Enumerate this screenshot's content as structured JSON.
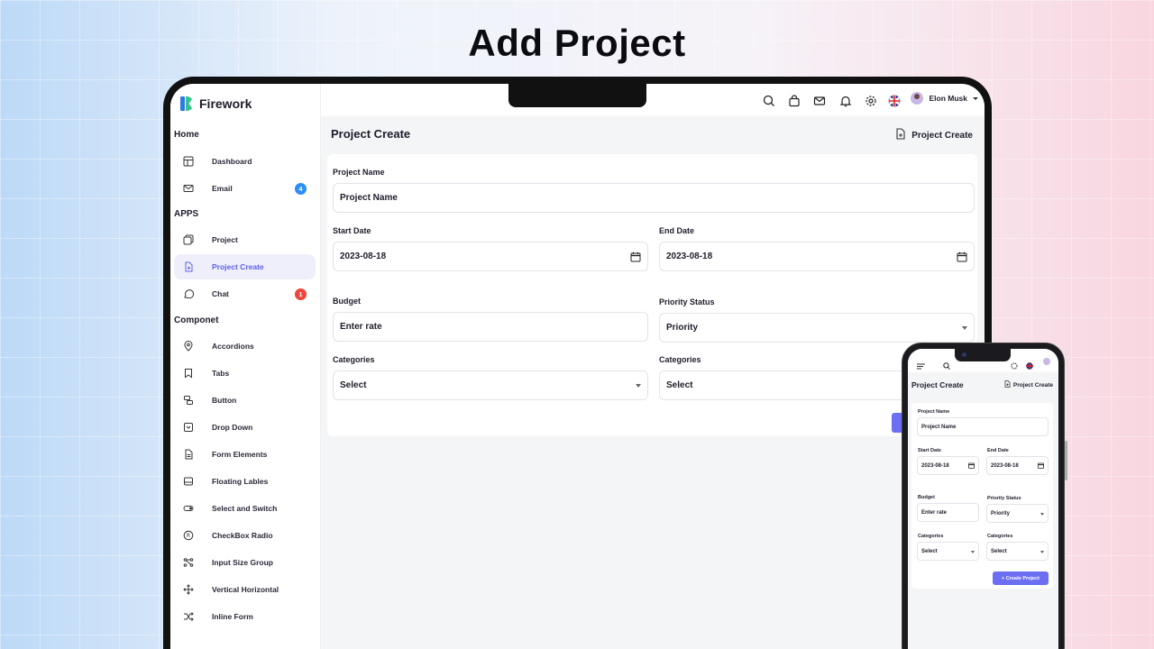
{
  "headline": "Add Project",
  "brand": "Firework",
  "sidebar": {
    "sections": [
      {
        "title": "Home"
      },
      {
        "title": "APPS"
      },
      {
        "title": "Componet"
      }
    ],
    "items": [
      {
        "label": "Dashboard",
        "icon": "layout-icon"
      },
      {
        "label": "Email",
        "icon": "mail-icon",
        "badge": "4"
      },
      {
        "label": "Project",
        "icon": "copy-icon"
      },
      {
        "label": "Project Create",
        "icon": "file-plus-icon",
        "active": true
      },
      {
        "label": "Chat",
        "icon": "chat-icon",
        "badge": "1"
      },
      {
        "label": "Accordions",
        "icon": "map-pin-icon"
      },
      {
        "label": "Tabs",
        "icon": "bookmark-icon"
      },
      {
        "label": "Button",
        "icon": "layers-icon"
      },
      {
        "label": "Drop Down",
        "icon": "dropdown-icon"
      },
      {
        "label": "Form Elements",
        "icon": "file-icon"
      },
      {
        "label": "Floating Lables",
        "icon": "inbox-icon"
      },
      {
        "label": "Select and Switch",
        "icon": "toggle-icon"
      },
      {
        "label": "CheckBox Radio",
        "icon": "registered-icon"
      },
      {
        "label": "Input Size Group",
        "icon": "nodes-icon"
      },
      {
        "label": "Vertical Horizontal",
        "icon": "move-icon"
      },
      {
        "label": "Inline Form",
        "icon": "shuffle-icon"
      }
    ],
    "badge_colors": {
      "email": "#2c8ef8",
      "chat": "#f1443b"
    }
  },
  "topbar": {
    "icons": [
      "search-icon",
      "bag-icon",
      "mail-icon",
      "bell-icon",
      "gear-icon",
      "uk-flag-icon"
    ],
    "user_name": "Elon Musk"
  },
  "page": {
    "title": "Project Create",
    "breadcrumb": "Project Create"
  },
  "form": {
    "project_name_label": "Project Name",
    "project_name_value": "Project Name",
    "start_date_label": "Start Date",
    "start_date_value": "2023-08-18",
    "end_date_label": "End Date",
    "end_date_value": "2023-08-18",
    "budget_label": "Budget",
    "budget_value": "Enter rate",
    "priority_label": "Priority Status",
    "priority_value": "Priority",
    "categories_label_1": "Categories",
    "categories_value_1": "Select",
    "categories_label_2": "Categories",
    "categories_value_2": "Select",
    "create_button": "+ Create Project"
  },
  "colors": {
    "accent": "#5d5fef",
    "button": "#6c6ff2"
  }
}
